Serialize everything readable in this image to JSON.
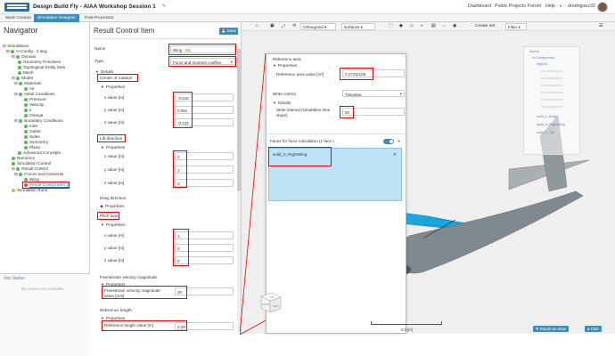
{
  "header": {
    "title": "Design Build Fly - AIAA Workshop Session 1",
    "nav": [
      "Dashboard",
      "Public Projects",
      "Forum",
      "Help"
    ],
    "user": "drodriguez32"
  },
  "tabs": [
    {
      "label": "Mesh Creator",
      "active": false
    },
    {
      "label": "Simulation Designer",
      "active": true
    },
    {
      "label": "Post-Processor",
      "active": false
    }
  ],
  "navigator": {
    "title": "Navigator",
    "tree": [
      {
        "label": "Simulations",
        "dot": "none"
      },
      {
        "label": "H-Config - 3 deg",
        "dot": "green"
      },
      {
        "label": "Domain",
        "dot": "green"
      },
      {
        "label": "Geometry Primitives",
        "dot": "green"
      },
      {
        "label": "Topological Entity Sets",
        "dot": "green"
      },
      {
        "label": "Mesh",
        "dot": "green"
      },
      {
        "label": "Model",
        "dot": "green"
      },
      {
        "label": "Materials",
        "dot": "green"
      },
      {
        "label": "Air",
        "dot": "green"
      },
      {
        "label": "Initial Conditions",
        "dot": "green"
      },
      {
        "label": "Pressure",
        "dot": "green"
      },
      {
        "label": "Velocity",
        "dot": "green"
      },
      {
        "label": "k",
        "dot": "green"
      },
      {
        "label": "Omega",
        "dot": "green"
      },
      {
        "label": "Boundary Conditions",
        "dot": "green"
      },
      {
        "label": "Inlet",
        "dot": "green"
      },
      {
        "label": "Outlet",
        "dot": "green"
      },
      {
        "label": "Sides",
        "dot": "green"
      },
      {
        "label": "Symmetry",
        "dot": "green"
      },
      {
        "label": "Plane",
        "dot": "green"
      },
      {
        "label": "Advanced Concepts",
        "dot": "green"
      },
      {
        "label": "Numerics",
        "dot": "green"
      },
      {
        "label": "Simulation Control",
        "dot": "green"
      },
      {
        "label": "Result Control",
        "dot": "green"
      },
      {
        "label": "Forces and moments",
        "dot": "green"
      },
      {
        "label": "Wing",
        "dot": "green"
      },
      {
        "label": "Result Control Item 2",
        "dot": "red"
      },
      {
        "label": "Simulation Runs",
        "dot": "yellow"
      }
    ],
    "job_status_title": "Job Status",
    "job_status_empty": "No active runs available"
  },
  "result_control": {
    "title": "Result Control Item",
    "save_label": "Save",
    "name_label": "Name",
    "name_value": "Wing - CL",
    "type_label": "Type",
    "type_value": "Force and moment coeffice",
    "details_label": "Details",
    "center_of_rotation": "Center of rotation",
    "properties": "Properties",
    "x_label": "x value [m]",
    "y_label": "y value [m]",
    "z_label": "z value [m]",
    "cor_x": "-0.515",
    "cor_y": "0.081",
    "cor_z": "-0.122",
    "lift_direction": "Lift direction",
    "lift_x": "0",
    "lift_y": "1",
    "lift_z": "0",
    "drag_direction": "Drag direction",
    "pitch_axis": "Pitch axis",
    "pitch_x": "1",
    "pitch_y": "0",
    "pitch_z": "0",
    "freestream_title": "Freestream velocity magnitude",
    "freestream_label": "Freestream velocity magnitude value [m/s]",
    "freestream_value": "20",
    "ref_length_title": "Reference length",
    "ref_length_label": "Reference length value [m]",
    "ref_length_value": "0.29"
  },
  "viewer": {
    "toolbar": [
      "Orthogonal",
      "surfaces",
      "Create set",
      "Filter"
    ],
    "legend_title": "Scene",
    "legend_items": [
      {
        "label": "H-Config mesh",
        "faded": false
      },
      {
        "label": "region1",
        "faded": false
      },
      {
        "label": "boundingBox1",
        "faded": true
      },
      {
        "label": "boundingBox2",
        "faded": true
      },
      {
        "label": "boundingBox3",
        "faded": true
      },
      {
        "label": "boundingBox4",
        "faded": true
      },
      {
        "label": "boundingBox5",
        "faded": true
      },
      {
        "label": "boundingBox6",
        "faded": true
      },
      {
        "label": "solid_0_Body",
        "faded": false
      },
      {
        "label": "solid_0_RightWing",
        "faded": false
      },
      {
        "label": "solid_0_Tail",
        "faded": false
      }
    ],
    "scale_label": "0.5 [m]",
    "report_issue": "Report an issue",
    "chat": "Chat",
    "axis_labels": [
      "FRONT",
      "RIGHT",
      "TOP"
    ]
  },
  "popup": {
    "reference_area": "Reference area",
    "properties": "Properties",
    "ref_area_label": "Reference area value [m²]",
    "ref_area_value": "0.27211108",
    "write_control_label": "Write control",
    "write_control_value": "Timestep",
    "details": "Details",
    "write_interval_label": "Write interval (simulation time steps)",
    "write_interval_value": "50",
    "faces_title": "Faces for force calculation",
    "faces_count": "(1 face )",
    "face_item": "solid_0_RightWing"
  },
  "colors": {
    "accent": "#3c8dbc",
    "highlight": "#e00000",
    "wing": "#1aa7e0",
    "body": "#7f8a90"
  }
}
